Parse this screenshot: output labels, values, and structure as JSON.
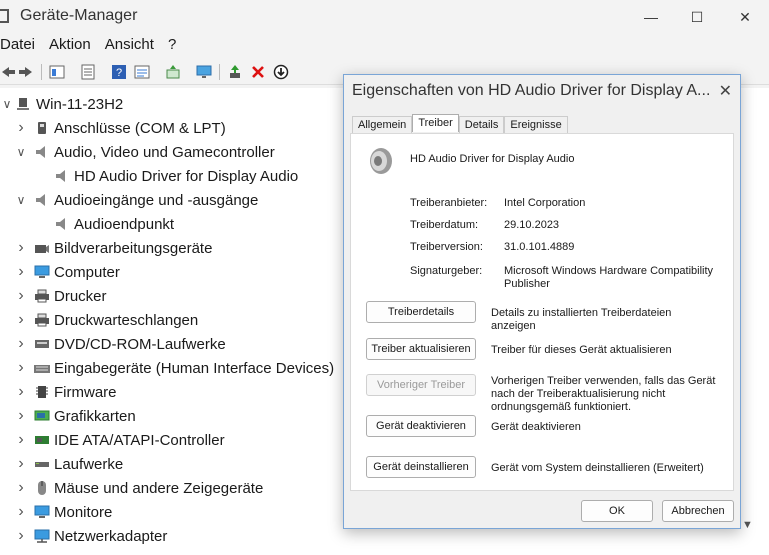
{
  "window": {
    "title": "Geräte-Manager"
  },
  "menu": [
    "Datei",
    "Aktion",
    "Ansicht",
    "?"
  ],
  "tree": {
    "root": "Win-11-23H2",
    "items": [
      {
        "label": "Anschlüsse (COM & LPT)",
        "expanded": false,
        "level": 1,
        "icon": "port-icon"
      },
      {
        "label": "Audio, Video und Gamecontroller",
        "expanded": true,
        "level": 1,
        "icon": "speaker-icon"
      },
      {
        "label": "HD Audio Driver for Display Audio",
        "level": 2,
        "icon": "speaker-icon"
      },
      {
        "label": "Audioeingänge und -ausgänge",
        "expanded": true,
        "level": 1,
        "icon": "speaker-icon"
      },
      {
        "label": "Audioendpunkt",
        "level": 2,
        "icon": "speaker-icon"
      },
      {
        "label": "Bildverarbeitungsgeräte",
        "expanded": false,
        "level": 1,
        "icon": "camera-icon"
      },
      {
        "label": "Computer",
        "expanded": false,
        "level": 1,
        "icon": "monitor-icon"
      },
      {
        "label": "Drucker",
        "expanded": false,
        "level": 1,
        "icon": "printer-icon"
      },
      {
        "label": "Druckwarteschlangen",
        "expanded": false,
        "level": 1,
        "icon": "printer-icon"
      },
      {
        "label": "DVD/CD-ROM-Laufwerke",
        "expanded": false,
        "level": 1,
        "icon": "disc-icon"
      },
      {
        "label": "Eingabegeräte (Human Interface Devices)",
        "expanded": false,
        "level": 1,
        "icon": "keyboard-icon"
      },
      {
        "label": "Firmware",
        "expanded": false,
        "level": 1,
        "icon": "chip-icon"
      },
      {
        "label": "Grafikkarten",
        "expanded": false,
        "level": 1,
        "icon": "display-adapter-icon"
      },
      {
        "label": "IDE ATA/ATAPI-Controller",
        "expanded": false,
        "level": 1,
        "icon": "controller-icon"
      },
      {
        "label": "Laufwerke",
        "expanded": false,
        "level": 1,
        "icon": "drive-icon"
      },
      {
        "label": "Mäuse und andere Zeigegeräte",
        "expanded": false,
        "level": 1,
        "icon": "mouse-icon"
      },
      {
        "label": "Monitore",
        "expanded": false,
        "level": 1,
        "icon": "monitor-icon"
      },
      {
        "label": "Netzwerkadapter",
        "expanded": false,
        "level": 1,
        "icon": "network-icon"
      }
    ]
  },
  "dialog": {
    "title": "Eigenschaften von HD Audio Driver for Display A...",
    "tabs": [
      "Allgemein",
      "Treiber",
      "Details",
      "Ereignisse"
    ],
    "active_tab": "Treiber",
    "device_name": "HD Audio Driver for Display Audio",
    "info": [
      {
        "label": "Treiberanbieter:",
        "value": "Intel Corporation"
      },
      {
        "label": "Treiberdatum:",
        "value": "29.10.2023"
      },
      {
        "label": "Treiberversion:",
        "value": "31.0.101.4889"
      },
      {
        "label": "Signaturgeber:",
        "value": "Microsoft Windows Hardware Compatibility Publisher"
      }
    ],
    "actions": [
      {
        "button": "Treiberdetails",
        "desc": "Details zu installierten Treiberdateien anzeigen",
        "enabled": true
      },
      {
        "button": "Treiber aktualisieren",
        "desc": "Treiber für dieses Gerät aktualisieren",
        "enabled": true
      },
      {
        "button": "Vorheriger Treiber",
        "desc": "Vorherigen Treiber verwenden, falls das Gerät nach der Treiberaktualisierung nicht ordnungsgemäß funktioniert.",
        "enabled": false
      },
      {
        "button": "Gerät deaktivieren",
        "desc": "Gerät deaktivieren",
        "enabled": true
      },
      {
        "button": "Gerät deinstallieren",
        "desc": "Gerät vom System deinstallieren (Erweitert)",
        "enabled": true
      }
    ],
    "ok": "OK",
    "cancel": "Abbrechen"
  }
}
